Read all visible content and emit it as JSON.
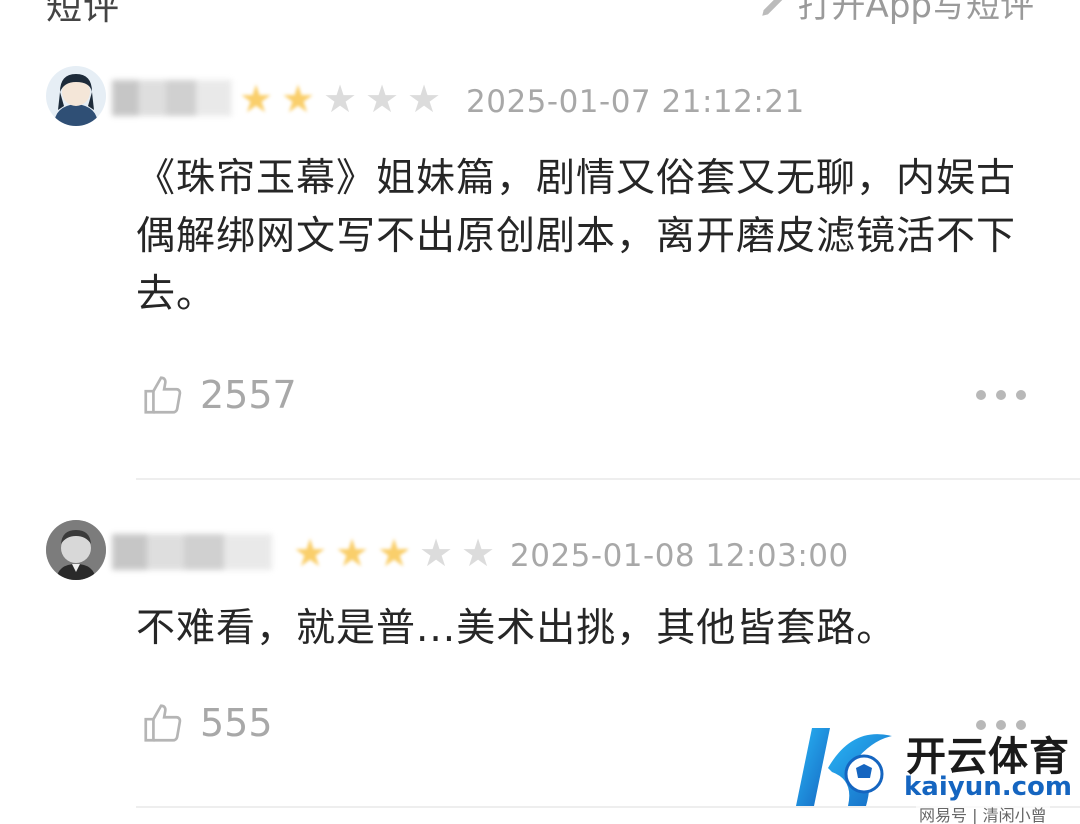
{
  "header": {
    "title": "短评",
    "write_action": "打开App写短评"
  },
  "comments": [
    {
      "username": "",
      "rating": 2,
      "max_rating": 5,
      "timestamp": "2025-01-07 21:12:21",
      "text": "《珠帘玉幕》姐妹篇，剧情又俗套又无聊，内娱古偶解绑网文写不出原创剧本，离开磨皮滤镜活不下去。",
      "likes": "2557"
    },
    {
      "username": "",
      "rating": 3,
      "max_rating": 5,
      "timestamp": "2025-01-08 12:03:00",
      "text": "不难看，就是普...美术出挑，其他皆套路。",
      "likes": "555"
    }
  ],
  "watermark": {
    "brand_cn": "开云体育",
    "brand_en": "kaiyun.com",
    "source": "网易号 | 清闲小曾"
  },
  "colors": {
    "star_on": "#f7b51c",
    "star_off": "#dcdcdc",
    "muted": "#a8a8a8",
    "brand_blue": "#1565c0"
  },
  "icons": [
    "pencil-icon",
    "thumb-up-icon",
    "more-icon",
    "star-icon",
    "kaiyun-logo"
  ]
}
